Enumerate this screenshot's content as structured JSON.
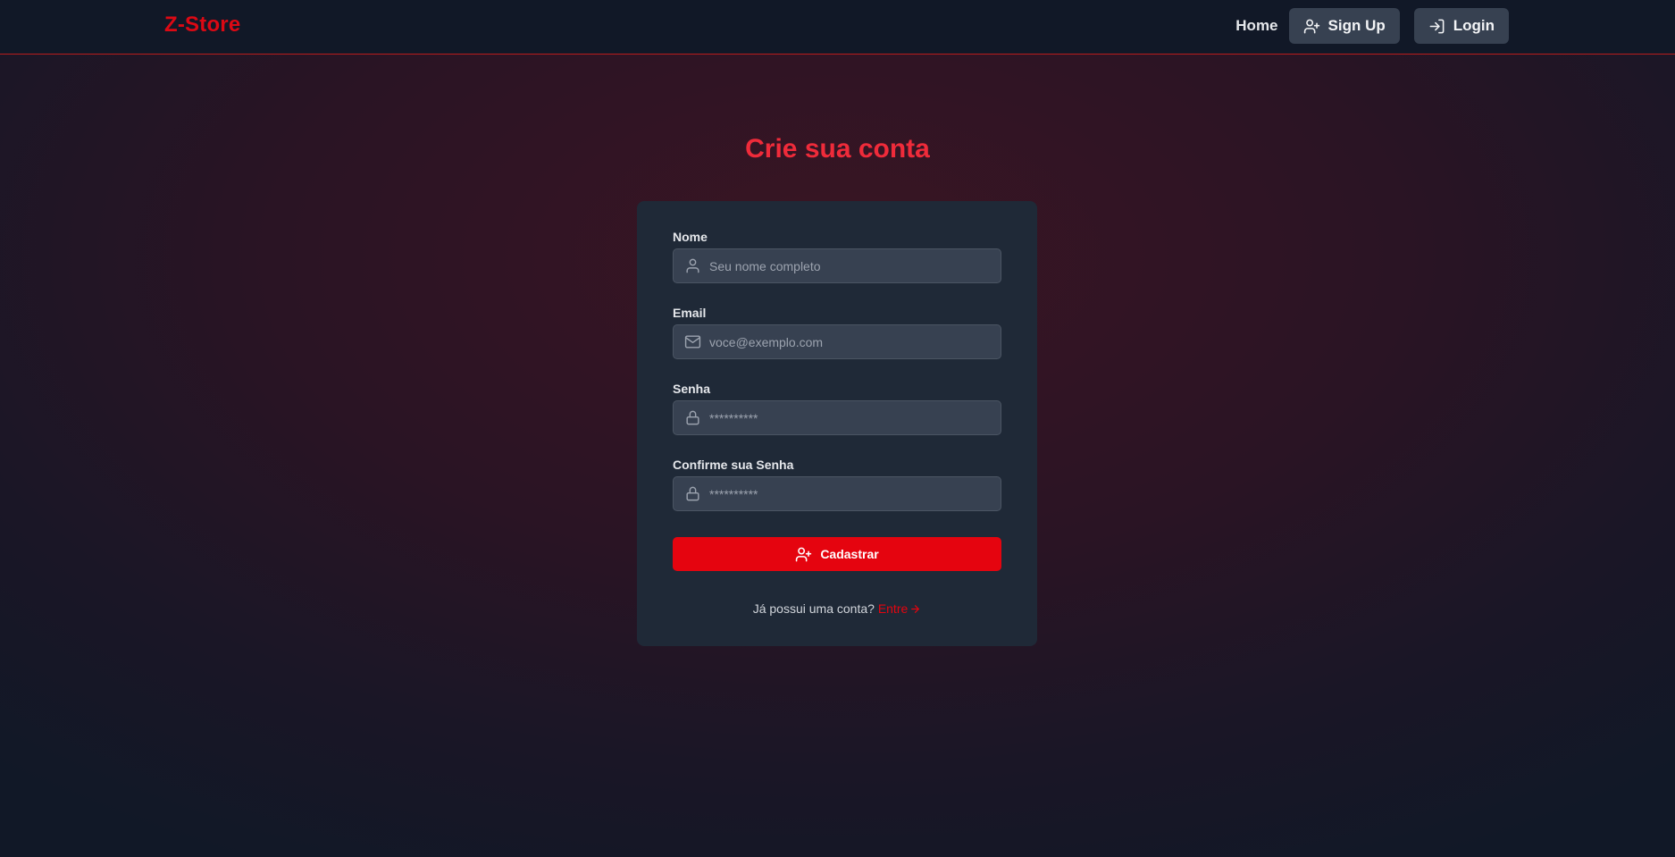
{
  "navbar": {
    "brand": "Z-Store",
    "home_label": "Home",
    "signup_label": "Sign Up",
    "login_label": "Login"
  },
  "page_title": "Crie sua conta",
  "form": {
    "name": {
      "label": "Nome",
      "placeholder": "Seu nome completo",
      "value": "",
      "icon": "user-icon"
    },
    "email": {
      "label": "Email",
      "placeholder": "voce@exemplo.com",
      "value": "",
      "icon": "mail-icon"
    },
    "password": {
      "label": "Senha",
      "placeholder": "**********",
      "value": "",
      "icon": "lock-icon"
    },
    "confirm_password": {
      "label": "Confirme sua Senha",
      "placeholder": "**********",
      "value": "",
      "icon": "lock-icon"
    },
    "submit_label": "Cadastrar"
  },
  "footer": {
    "question": "Já possui uma conta?",
    "link_label": "Entre"
  },
  "colors": {
    "accent": "#e5040f",
    "title": "#ef2b3a",
    "card": "#1f2937",
    "navbar": "#111827",
    "input": "#374151"
  }
}
